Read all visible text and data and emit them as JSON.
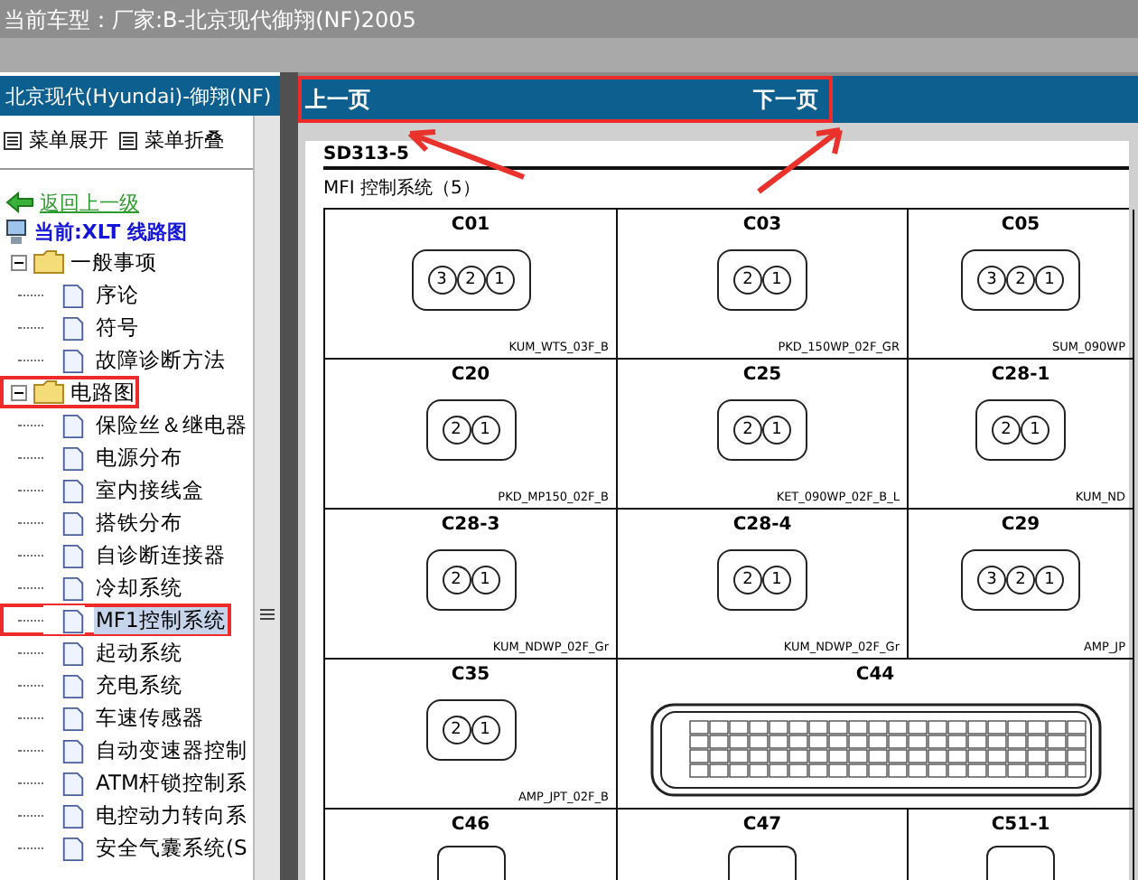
{
  "top_bar": {
    "title": "当前车型：厂家:B-北京现代御翔(NF)2005"
  },
  "sidebar": {
    "title": "北京现代(Hyundai)-御翔(NF)",
    "toolbar": [
      "菜单展开",
      "菜单折叠"
    ],
    "back_link": "返回上一级",
    "current": "当前:XLT 线路图",
    "tree": [
      {
        "label": "一般事项",
        "expanded": true,
        "annotated": false,
        "children": [
          {
            "label": "序论",
            "selected": false,
            "annotated": false
          },
          {
            "label": "符号",
            "selected": false,
            "annotated": false
          },
          {
            "label": "故障诊断方法",
            "selected": false,
            "annotated": false
          }
        ]
      },
      {
        "label": "电路图",
        "expanded": true,
        "annotated": true,
        "children": [
          {
            "label": "保险丝＆继电器",
            "selected": false,
            "annotated": false
          },
          {
            "label": "电源分布",
            "selected": false,
            "annotated": false
          },
          {
            "label": "室内接线盒",
            "selected": false,
            "annotated": false
          },
          {
            "label": "搭铁分布",
            "selected": false,
            "annotated": false
          },
          {
            "label": "自诊断连接器",
            "selected": false,
            "annotated": false
          },
          {
            "label": "冷却系统",
            "selected": false,
            "annotated": false
          },
          {
            "label": "MF1控制系统",
            "selected": true,
            "annotated": true
          },
          {
            "label": "起动系统",
            "selected": false,
            "annotated": false
          },
          {
            "label": "充电系统",
            "selected": false,
            "annotated": false
          },
          {
            "label": "车速传感器",
            "selected": false,
            "annotated": false
          },
          {
            "label": "自动变速器控制",
            "selected": false,
            "annotated": false
          },
          {
            "label": "ATM杆锁控制系",
            "selected": false,
            "annotated": false
          },
          {
            "label": "电控动力转向系",
            "selected": false,
            "annotated": false
          },
          {
            "label": "安全气囊系统(S",
            "selected": false,
            "annotated": false
          }
        ]
      }
    ]
  },
  "viewer": {
    "prev": "上一页",
    "next": "下一页",
    "annotated": true
  },
  "document": {
    "code": "SD313-5",
    "title": "MFI 控制系统（5）",
    "connectors": [
      {
        "label": "C01",
        "kind": "pins",
        "pins": [
          "3",
          "2",
          "1"
        ],
        "part": "KUM_WTS_03F_B"
      },
      {
        "label": "C03",
        "kind": "pins",
        "pins": [
          "2",
          "1"
        ],
        "part": "PKD_150WP_02F_GR"
      },
      {
        "label": "C05",
        "kind": "pins",
        "pins": [
          "3",
          "2",
          "1"
        ],
        "part": "SUM_090WP"
      },
      {
        "label": "C20",
        "kind": "pins",
        "pins": [
          "2",
          "1"
        ],
        "part": "PKD_MP150_02F_B"
      },
      {
        "label": "C25",
        "kind": "pins",
        "pins": [
          "2",
          "1"
        ],
        "part": "KET_090WP_02F_B_L"
      },
      {
        "label": "C28-1",
        "kind": "pins",
        "pins": [
          "2",
          "1"
        ],
        "part": "KUM_ND"
      },
      {
        "label": "C28-3",
        "kind": "pins",
        "pins": [
          "2",
          "1"
        ],
        "part": "KUM_NDWP_02F_Gr"
      },
      {
        "label": "C28-4",
        "kind": "pins",
        "pins": [
          "2",
          "1"
        ],
        "part": "KUM_NDWP_02F_Gr"
      },
      {
        "label": "C29",
        "kind": "pins",
        "pins": [
          "3",
          "2",
          "1"
        ],
        "part": "AMP_JP"
      },
      {
        "label": "C35",
        "kind": "pins",
        "pins": [
          "2",
          "1"
        ],
        "part": "AMP_JPT_02F_B"
      },
      {
        "label": "C44",
        "kind": "block"
      },
      {
        "label": "C46",
        "kind": "cut"
      },
      {
        "label": "C47",
        "kind": "cut"
      },
      {
        "label": "C51-1",
        "kind": "cut"
      }
    ]
  }
}
